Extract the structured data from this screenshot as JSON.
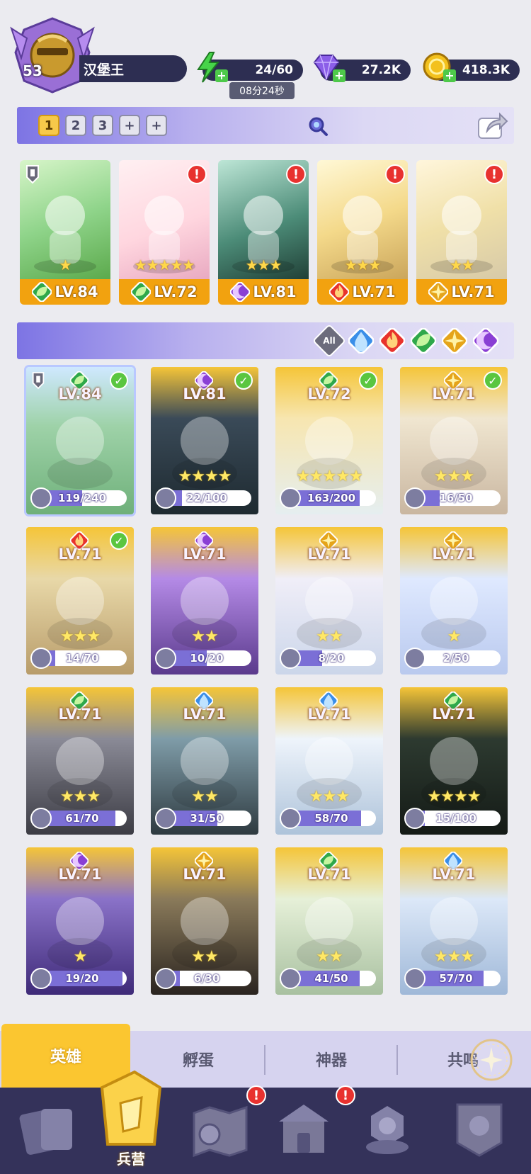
{
  "player": {
    "level": "53",
    "name": "汉堡王"
  },
  "resources": {
    "energy": "24/60",
    "energy_timer": "08分24秒",
    "gems": "27.2K",
    "gold": "418.3K"
  },
  "team_tabs": [
    "1",
    "2",
    "3",
    "+",
    "+"
  ],
  "team": [
    {
      "level": "LV.84",
      "element": "leaf",
      "stars": 1,
      "alert": false
    },
    {
      "level": "LV.72",
      "element": "leaf",
      "stars": 5,
      "alert": true
    },
    {
      "level": "LV.81",
      "element": "moon",
      "stars": 3,
      "alert": true
    },
    {
      "level": "LV.71",
      "element": "fire",
      "stars": 3,
      "alert": true
    },
    {
      "level": "LV.71",
      "element": "light",
      "stars": 2,
      "alert": true
    }
  ],
  "filters": {
    "all_label": "All",
    "elements": [
      "water",
      "fire",
      "leaf",
      "light",
      "moon"
    ]
  },
  "colors": {
    "water": "#3a8ee8",
    "fire": "#e8332c",
    "leaf": "#2fa84a",
    "light": "#e5a41a",
    "moon": "#8a3fd4",
    "accent_yellow": "#fbc630",
    "nav_bg": "#34325a"
  },
  "heroes": [
    {
      "level": "LV.84",
      "element": "leaf",
      "progress": "119/240",
      "fraction": 0.5,
      "stars": 0,
      "checked": true,
      "selected": true
    },
    {
      "level": "LV.81",
      "element": "moon",
      "progress": "22/100",
      "fraction": 0.22,
      "stars": 4,
      "checked": true
    },
    {
      "level": "LV.72",
      "element": "leaf",
      "progress": "163/200",
      "fraction": 0.82,
      "stars": 5,
      "checked": true
    },
    {
      "level": "LV.71",
      "element": "light",
      "progress": "16/50",
      "fraction": 0.32,
      "stars": 3,
      "checked": true
    },
    {
      "level": "LV.71",
      "element": "fire",
      "progress": "14/70",
      "fraction": 0.2,
      "stars": 3,
      "checked": true
    },
    {
      "level": "LV.71",
      "element": "moon",
      "progress": "10/20",
      "fraction": 0.5,
      "stars": 2,
      "checked": false
    },
    {
      "level": "LV.71",
      "element": "light",
      "progress": "8/20",
      "fraction": 0.4,
      "stars": 2,
      "checked": false
    },
    {
      "level": "LV.71",
      "element": "light",
      "progress": "2/50",
      "fraction": 0.04,
      "stars": 1,
      "checked": false
    },
    {
      "level": "LV.71",
      "element": "leaf",
      "progress": "61/70",
      "fraction": 0.87,
      "stars": 3,
      "checked": false
    },
    {
      "level": "LV.71",
      "element": "water",
      "progress": "31/50",
      "fraction": 0.62,
      "stars": 2,
      "checked": false
    },
    {
      "level": "LV.71",
      "element": "water",
      "progress": "58/70",
      "fraction": 0.83,
      "stars": 3,
      "checked": false
    },
    {
      "level": "LV.71",
      "element": "leaf",
      "progress": "15/100",
      "fraction": 0.15,
      "stars": 4,
      "checked": false
    },
    {
      "level": "LV.71",
      "element": "moon",
      "progress": "19/20",
      "fraction": 0.95,
      "stars": 1,
      "checked": false
    },
    {
      "level": "LV.71",
      "element": "light",
      "progress": "6/30",
      "fraction": 0.2,
      "stars": 2,
      "checked": false
    },
    {
      "level": "LV.71",
      "element": "leaf",
      "progress": "41/50",
      "fraction": 0.82,
      "stars": 2,
      "checked": false
    },
    {
      "level": "LV.71",
      "element": "water",
      "progress": "57/70",
      "fraction": 0.81,
      "stars": 3,
      "checked": false
    }
  ],
  "subtabs": [
    "英雄",
    "孵蛋",
    "神器",
    "共鸣"
  ],
  "nav": {
    "active_label": "兵营",
    "items": [
      "cards-icon",
      "barracks-icon",
      "map-icon",
      "temple-icon",
      "summon-icon",
      "guild-icon"
    ]
  }
}
